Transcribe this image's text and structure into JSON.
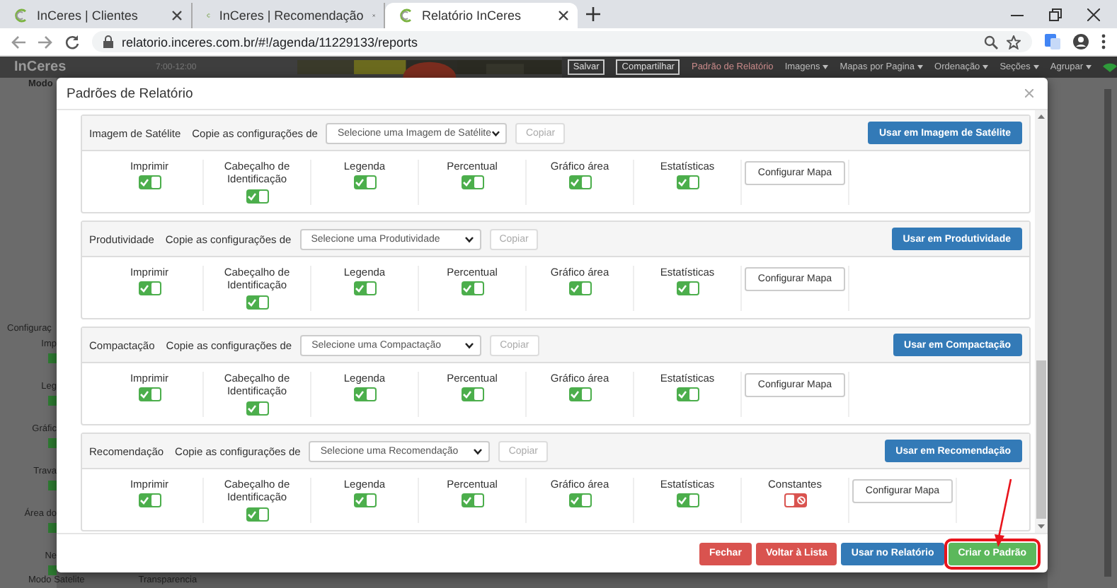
{
  "browser": {
    "tabs": [
      {
        "title": "InCeres | Clientes",
        "selected": false
      },
      {
        "title": "InCeres | Recomendação",
        "selected": false
      },
      {
        "title": "Relatório InCeres",
        "selected": true
      }
    ],
    "url": "relatorio.inceres.com.br/#!/agenda/11229133/reports"
  },
  "app": {
    "logo": "InCeres",
    "mode_label": "Modo",
    "time_label": "7:00-12:00",
    "toolbar": [
      {
        "label": "Salvar",
        "kind": "outline"
      },
      {
        "label": "Compartilhar",
        "kind": "outline"
      },
      {
        "label": "Padrão de Relatório",
        "kind": "link"
      },
      {
        "label": "Imagens",
        "kind": "menu"
      },
      {
        "label": "Mapas por Pagina",
        "kind": "menu"
      },
      {
        "label": "Ordenação",
        "kind": "menu"
      },
      {
        "label": "Seções",
        "kind": "menu"
      },
      {
        "label": "Agrupar",
        "kind": "menu"
      }
    ],
    "sidebar_title": "Configuraç",
    "sidebar_items": [
      {
        "label": "Imp",
        "checked": true
      },
      {
        "label": "Leg",
        "checked": true
      },
      {
        "label": "Gráfic",
        "checked": true
      },
      {
        "label": "Trava",
        "checked": true
      },
      {
        "label": "Área do",
        "checked": true
      },
      {
        "label": "Ne",
        "checked": true
      }
    ],
    "bottom_labels": [
      "Modo Satelite",
      "Transparencia"
    ]
  },
  "dialog": {
    "title": "Padrões de Relatório",
    "sections": [
      {
        "title": "Imagem de Satélite",
        "copy_label": "Copie as configurações de",
        "select_value": "Selecione uma Imagem de Satélite",
        "copy_button": "Copiar",
        "use_button": "Usar em Imagem de Satélite",
        "options": [
          {
            "kind": "toggle",
            "label": "Imprimir",
            "on": true
          },
          {
            "kind": "toggle",
            "label": "Cabeçalho de Identificação",
            "on": true
          },
          {
            "kind": "toggle",
            "label": "Legenda",
            "on": true
          },
          {
            "kind": "toggle",
            "label": "Percentual",
            "on": true
          },
          {
            "kind": "toggle",
            "label": "Gráfico área",
            "on": true
          },
          {
            "kind": "toggle",
            "label": "Estatísticas",
            "on": true
          },
          {
            "kind": "button",
            "label": "Configurar Mapa"
          }
        ]
      },
      {
        "title": "Produtividade",
        "copy_label": "Copie as configurações de",
        "select_value": "Selecione uma Produtividade",
        "copy_button": "Copiar",
        "use_button": "Usar em Produtividade",
        "options": [
          {
            "kind": "toggle",
            "label": "Imprimir",
            "on": true
          },
          {
            "kind": "toggle",
            "label": "Cabeçalho de Identificação",
            "on": true
          },
          {
            "kind": "toggle",
            "label": "Legenda",
            "on": true
          },
          {
            "kind": "toggle",
            "label": "Percentual",
            "on": true
          },
          {
            "kind": "toggle",
            "label": "Gráfico área",
            "on": true
          },
          {
            "kind": "toggle",
            "label": "Estatísticas",
            "on": true
          },
          {
            "kind": "button",
            "label": "Configurar Mapa"
          }
        ]
      },
      {
        "title": "Compactação",
        "copy_label": "Copie as configurações de",
        "select_value": "Selecione uma Compactação",
        "copy_button": "Copiar",
        "use_button": "Usar em Compactação",
        "options": [
          {
            "kind": "toggle",
            "label": "Imprimir",
            "on": true
          },
          {
            "kind": "toggle",
            "label": "Cabeçalho de Identificação",
            "on": true
          },
          {
            "kind": "toggle",
            "label": "Legenda",
            "on": true
          },
          {
            "kind": "toggle",
            "label": "Percentual",
            "on": true
          },
          {
            "kind": "toggle",
            "label": "Gráfico área",
            "on": true
          },
          {
            "kind": "toggle",
            "label": "Estatísticas",
            "on": true
          },
          {
            "kind": "button",
            "label": "Configurar Mapa"
          }
        ]
      },
      {
        "title": "Recomendação",
        "copy_label": "Copie as configurações de",
        "select_value": "Selecione uma Recomendação",
        "copy_button": "Copiar",
        "use_button": "Usar em Recomendação",
        "options": [
          {
            "kind": "toggle",
            "label": "Imprimir",
            "on": true
          },
          {
            "kind": "toggle",
            "label": "Cabeçalho de Identificação",
            "on": true
          },
          {
            "kind": "toggle",
            "label": "Legenda",
            "on": true
          },
          {
            "kind": "toggle",
            "label": "Percentual",
            "on": true
          },
          {
            "kind": "toggle",
            "label": "Gráfico área",
            "on": true
          },
          {
            "kind": "toggle",
            "label": "Estatísticas",
            "on": true
          },
          {
            "kind": "toggle",
            "label": "Constantes",
            "on": false
          },
          {
            "kind": "button",
            "label": "Configurar Mapa"
          }
        ]
      }
    ],
    "footer_buttons": [
      {
        "label": "Fechar",
        "kind": "danger",
        "highlighted": false
      },
      {
        "label": "Voltar à Lista",
        "kind": "danger",
        "highlighted": false
      },
      {
        "label": "Usar no Relatório",
        "kind": "primary",
        "highlighted": false
      },
      {
        "label": "Criar o Padrão",
        "kind": "success",
        "highlighted": true
      }
    ]
  }
}
